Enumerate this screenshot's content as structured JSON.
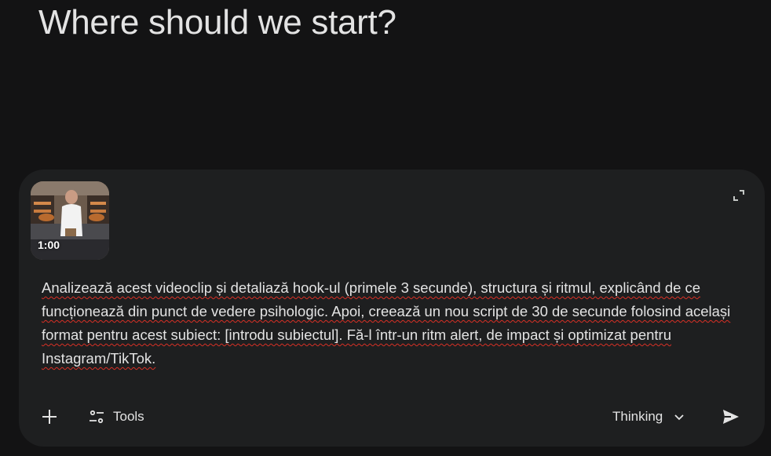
{
  "headline": "Where should we start?",
  "composer": {
    "attachment": {
      "type": "video",
      "duration": "1:00",
      "icon": "video-thumbnail"
    },
    "expand_icon": "expand-icon",
    "prompt_text": "Analizează acest videoclip și detaliază hook-ul (primele 3 secunde), structura și ritmul, explicând de ce funcționează din punct de vedere psihologic. Apoi, creează un nou script de 30 de secunde folosind același format pentru acest subiect: [introdu subiectul]. Fă-l într-un ritm alert, de impact și optimizat pentru Instagram/TikTok.",
    "toolbar": {
      "add_icon": "plus-icon",
      "tools_icon": "tools-sliders-icon",
      "tools_label": "Tools",
      "mode_label": "Thinking",
      "mode_icon": "chevron-down-icon",
      "send_icon": "send-icon"
    }
  },
  "colors": {
    "background": "#131314",
    "composer": "#1e1f20",
    "text": "#e3e3e3",
    "spellcheck": "#d93025"
  }
}
